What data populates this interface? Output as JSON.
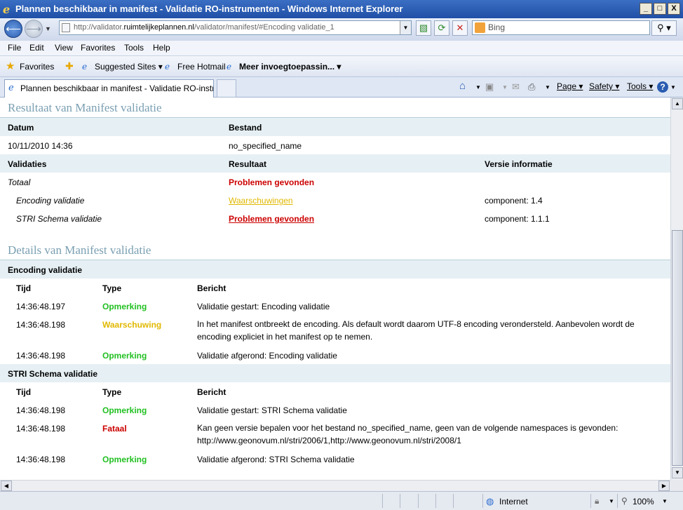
{
  "window": {
    "title": "Plannen beschikbaar in manifest - Validatie RO-instrumenten - Windows Internet Explorer",
    "btn_min": "_",
    "btn_max": "□",
    "btn_close": "X"
  },
  "address": {
    "url_prefix": "http://validator.",
    "url_domain": "ruimtelijkeplannen.nl",
    "url_suffix": "/validator/manifest/#Encoding validatie_1",
    "search_placeholder": "Bing"
  },
  "menu": [
    "File",
    "Edit",
    "View",
    "Favorites",
    "Tools",
    "Help"
  ],
  "favorites": {
    "favorites_label": "Favorites",
    "suggested": "Suggested Sites ▾",
    "hotmail": "Free Hotmail",
    "more": "Meer invoegtoepassin... ▾"
  },
  "tab": {
    "title": "Plannen beschikbaar in manifest - Validatie RO-instru..."
  },
  "commandbar": {
    "page": "Page ▾",
    "safety": "Safety ▾",
    "tools": "Tools ▾"
  },
  "manifest_result": {
    "section_title": "Resultaat van Manifest validatie",
    "col_datum": "Datum",
    "col_bestand": "Bestand",
    "datum": "10/11/2010 14:36",
    "bestand": "no_specified_name",
    "col_validaties": "Validaties",
    "col_resultaat": "Resultaat",
    "col_versie": "Versie informatie",
    "rows": [
      {
        "name": "Totaal",
        "result": "Problemen gevonden",
        "version": ""
      },
      {
        "name": "Encoding validatie",
        "result": "Waarschuwingen",
        "version": "component: 1.4"
      },
      {
        "name": "STRI Schema validatie",
        "result": "Problemen gevonden",
        "version": "component: 1.1.1"
      }
    ]
  },
  "details": {
    "section_title": "Details van Manifest validatie",
    "col_tijd": "Tijd",
    "col_type": "Type",
    "col_bericht": "Bericht",
    "encoding": {
      "title": "Encoding validatie",
      "rows": [
        {
          "time": "14:36:48.197",
          "type": "Opmerking",
          "msg": "Validatie gestart: Encoding validatie"
        },
        {
          "time": "14:36:48.198",
          "type": "Waarschuwing",
          "msg": "In het manifest ontbreekt de encoding. Als default wordt daarom UTF-8 encoding verondersteld. Aanbevolen wordt de encoding expliciet in het manifest op te nemen."
        },
        {
          "time": "14:36:48.198",
          "type": "Opmerking",
          "msg": "Validatie afgerond: Encoding validatie"
        }
      ]
    },
    "stri": {
      "title": "STRI Schema validatie",
      "rows": [
        {
          "time": "14:36:48.198",
          "type": "Opmerking",
          "msg": "Validatie gestart: STRI Schema validatie"
        },
        {
          "time": "14:36:48.198",
          "type": "Fataal",
          "msg": "Kan geen versie bepalen voor het bestand no_specified_name, geen van de volgende namespaces is gevonden: http://www.geonovum.nl/stri/2006/1,http://www.geonovum.nl/stri/2008/1"
        },
        {
          "time": "14:36:48.198",
          "type": "Opmerking",
          "msg": "Validatie afgerond: STRI Schema validatie"
        }
      ]
    }
  },
  "status": {
    "zone": "Internet",
    "zoom": "100%"
  }
}
